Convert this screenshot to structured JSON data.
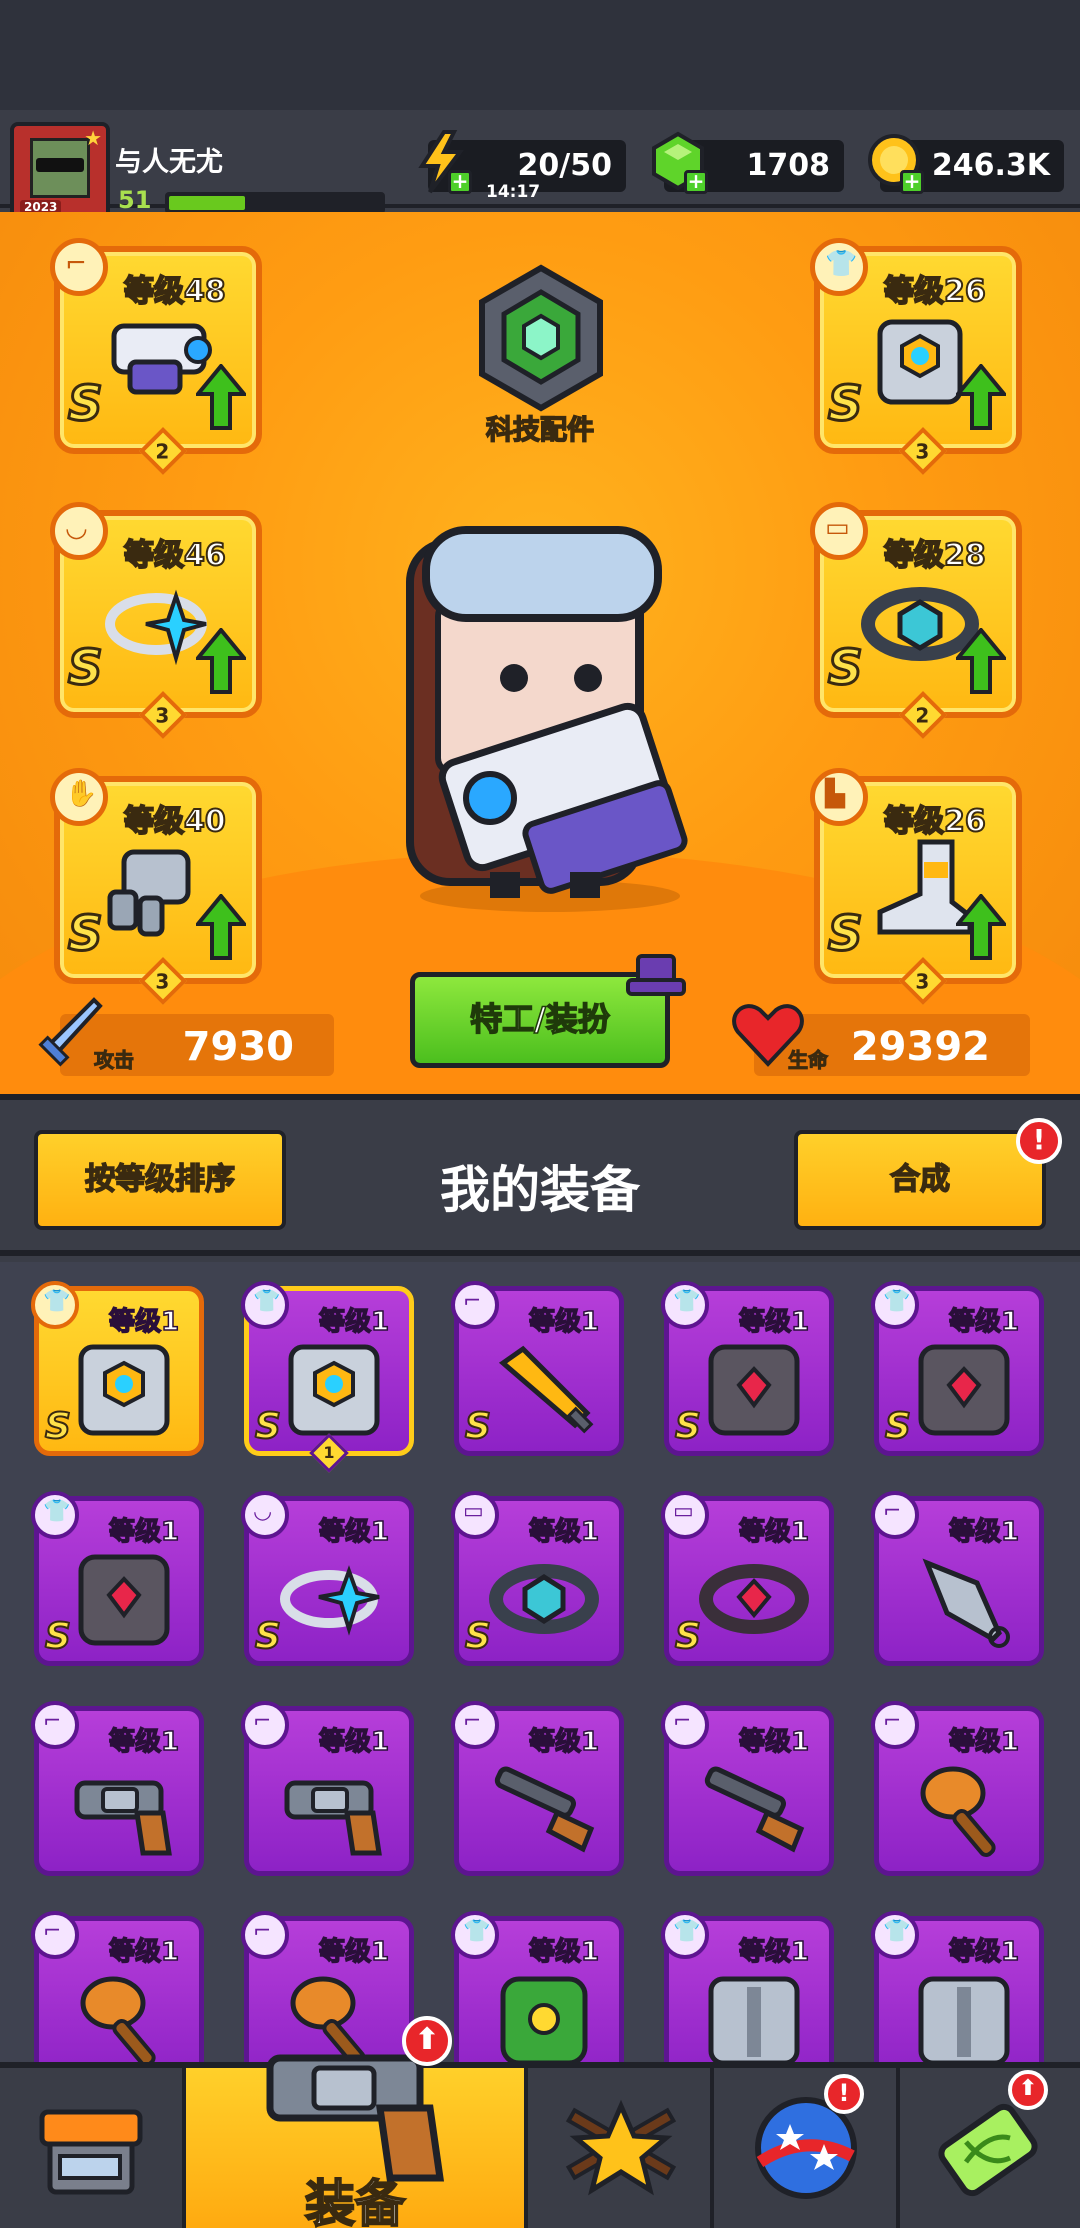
{
  "player": {
    "name": "与人无尤",
    "level": "51",
    "xp_fraction": 0.36,
    "avatar_year": "2023"
  },
  "resources": {
    "energy": "20/50",
    "energy_timer": "14:17",
    "gems": "1708",
    "coins": "246.3K"
  },
  "hero": {
    "tech_label": "科技配件",
    "costume_button": "特工/装扮",
    "attack_label": "攻击",
    "attack_value": "7930",
    "hp_label": "生命",
    "hp_value": "29392",
    "slots": [
      {
        "level": "等级48",
        "rank": "S",
        "stars": "2",
        "icon": "weapon-icon",
        "art": "blaster"
      },
      {
        "level": "等级46",
        "rank": "S",
        "stars": "3",
        "icon": "necklace-icon",
        "art": "ring"
      },
      {
        "level": "等级40",
        "rank": "S",
        "stars": "3",
        "icon": "glove-icon",
        "art": "glove"
      },
      {
        "level": "等级26",
        "rank": "S",
        "stars": "3",
        "icon": "armor-icon",
        "art": "armor"
      },
      {
        "level": "等级28",
        "rank": "S",
        "stars": "2",
        "icon": "belt-icon",
        "art": "belt"
      },
      {
        "level": "等级26",
        "rank": "S",
        "stars": "3",
        "icon": "boot-icon",
        "art": "boot"
      }
    ]
  },
  "equipment": {
    "sort_button": "按等级排序",
    "title": "我的装备",
    "merge_button": "合成",
    "merge_alert": "!",
    "items": [
      {
        "level": "等级1",
        "rank": "S",
        "style": "gold",
        "icon": "armor-icon",
        "art": "armor",
        "stars": ""
      },
      {
        "level": "等级1",
        "rank": "S",
        "style": "purple-selected",
        "icon": "armor-icon",
        "art": "armor",
        "stars": "1"
      },
      {
        "level": "等级1",
        "rank": "S",
        "style": "purple",
        "icon": "weapon-icon",
        "art": "sword",
        "stars": ""
      },
      {
        "level": "等级1",
        "rank": "S",
        "style": "purple",
        "icon": "armor-icon",
        "art": "dark-armor",
        "stars": ""
      },
      {
        "level": "等级1",
        "rank": "S",
        "style": "purple",
        "icon": "armor-icon",
        "art": "dark-armor",
        "stars": ""
      },
      {
        "level": "等级1",
        "rank": "S",
        "style": "purple",
        "icon": "armor-icon",
        "art": "dark-armor",
        "stars": ""
      },
      {
        "level": "等级1",
        "rank": "S",
        "style": "purple",
        "icon": "necklace-icon",
        "art": "ring",
        "stars": ""
      },
      {
        "level": "等级1",
        "rank": "S",
        "style": "purple",
        "icon": "belt-icon",
        "art": "belt",
        "stars": ""
      },
      {
        "level": "等级1",
        "rank": "S",
        "style": "purple",
        "icon": "belt-icon",
        "art": "dark-belt",
        "stars": ""
      },
      {
        "level": "等级1",
        "rank": "",
        "style": "purple",
        "icon": "weapon-icon",
        "art": "kunai",
        "stars": ""
      },
      {
        "level": "等级1",
        "rank": "",
        "style": "purple",
        "icon": "weapon-icon",
        "art": "revolver",
        "stars": ""
      },
      {
        "level": "等级1",
        "rank": "",
        "style": "purple",
        "icon": "weapon-icon",
        "art": "revolver",
        "stars": ""
      },
      {
        "level": "等级1",
        "rank": "",
        "style": "purple",
        "icon": "weapon-icon",
        "art": "shotgun",
        "stars": ""
      },
      {
        "level": "等级1",
        "rank": "",
        "style": "purple",
        "icon": "weapon-icon",
        "art": "shotgun",
        "stars": ""
      },
      {
        "level": "等级1",
        "rank": "",
        "style": "purple",
        "icon": "weapon-icon",
        "art": "club",
        "stars": ""
      },
      {
        "level": "等级1",
        "rank": "",
        "style": "purple",
        "icon": "weapon-icon",
        "art": "club",
        "stars": ""
      },
      {
        "level": "等级1",
        "rank": "",
        "style": "purple",
        "icon": "weapon-icon",
        "art": "club",
        "stars": ""
      },
      {
        "level": "等级1",
        "rank": "",
        "style": "purple",
        "icon": "armor-icon",
        "art": "leaf-armor",
        "stars": ""
      },
      {
        "level": "等级1",
        "rank": "",
        "style": "purple",
        "icon": "armor-icon",
        "art": "steel-armor",
        "stars": ""
      },
      {
        "level": "等级1",
        "rank": "",
        "style": "purple",
        "icon": "armor-icon",
        "art": "steel-armor",
        "stars": ""
      }
    ]
  },
  "nav": {
    "tabs": [
      {
        "name": "shop",
        "label": "",
        "icon": "shop-icon",
        "badge": ""
      },
      {
        "name": "equipment",
        "label": "装备",
        "icon": "revolver-icon",
        "badge": "⬆",
        "active": true
      },
      {
        "name": "battle",
        "label": "",
        "icon": "star-swords-icon",
        "badge": ""
      },
      {
        "name": "planet",
        "label": "",
        "icon": "planet-icon",
        "badge": "!"
      },
      {
        "name": "lab",
        "label": "",
        "icon": "dna-capsule-icon",
        "badge": "⬆"
      }
    ]
  },
  "colors": {
    "accent_orange": "#ff9c12",
    "gold_card": "#ffd931",
    "purple_card": "#a02fd0",
    "green_button": "#4cbf1e",
    "alert_red": "#e8262a"
  }
}
